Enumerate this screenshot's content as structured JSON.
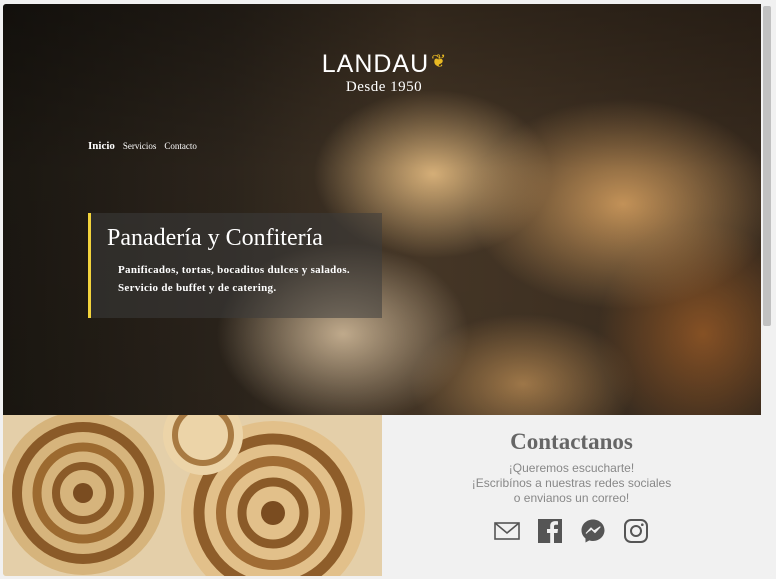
{
  "brand": {
    "name": "LANDAU",
    "since": "Desde 1950",
    "accent_color": "#f2d33c"
  },
  "nav": {
    "items": [
      {
        "label": "Inicio",
        "active": true
      },
      {
        "label": "Servicios",
        "active": false
      },
      {
        "label": "Contacto",
        "active": false
      }
    ]
  },
  "hero": {
    "title": "Panadería y Confitería",
    "line1": "Panificados, tortas, bocaditos dulces y salados.",
    "line2": "Servicio de buffet y de catering."
  },
  "contact": {
    "title": "Contactanos",
    "line1": "¡Queremos escucharte!",
    "line2": "¡Escribínos a nuestras redes sociales",
    "line3": "o envianos un correo!",
    "icons": [
      "mail-icon",
      "facebook-icon",
      "messenger-icon",
      "instagram-icon"
    ]
  }
}
